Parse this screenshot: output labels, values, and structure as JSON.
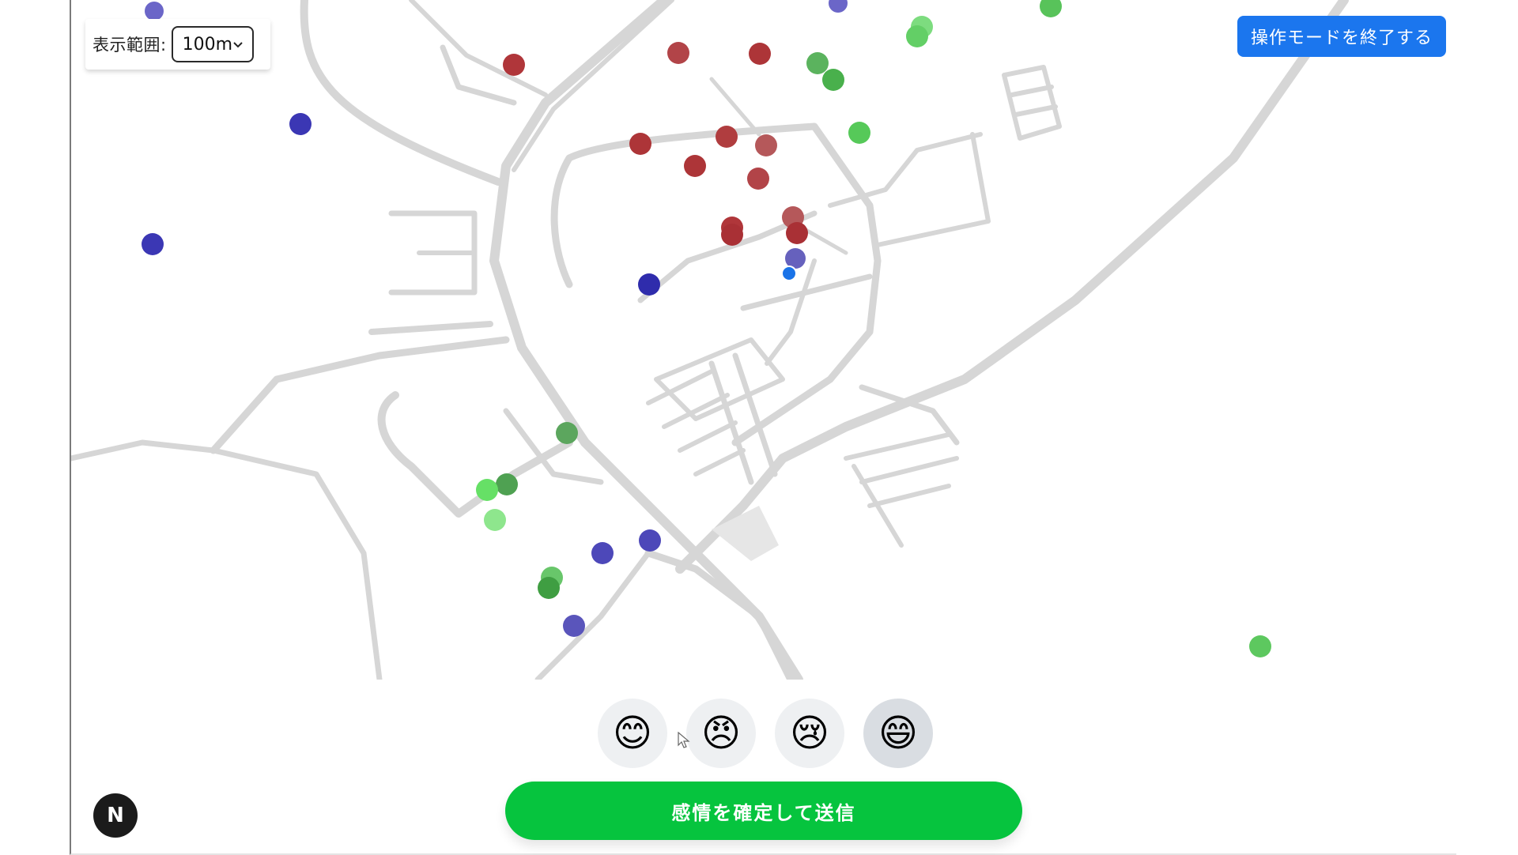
{
  "map": {
    "range_label": "表示範囲:",
    "range_value": "100m",
    "colors": {
      "road": "#d6d6d6",
      "happy": "#58c35a",
      "angry": "#b53a3d",
      "sad": "#4645b8",
      "current_location": "#1a73e8"
    }
  },
  "header": {
    "exit_button": "操作モードを終了する"
  },
  "emotions": [
    {
      "id": "smile",
      "emoji": "😊"
    },
    {
      "id": "angry",
      "emoji": "😠"
    },
    {
      "id": "sad",
      "emoji": "😢"
    },
    {
      "id": "grin",
      "emoji": "😄",
      "selected": true
    }
  ],
  "submit_button": "感情を確定して送信",
  "badge": "N"
}
